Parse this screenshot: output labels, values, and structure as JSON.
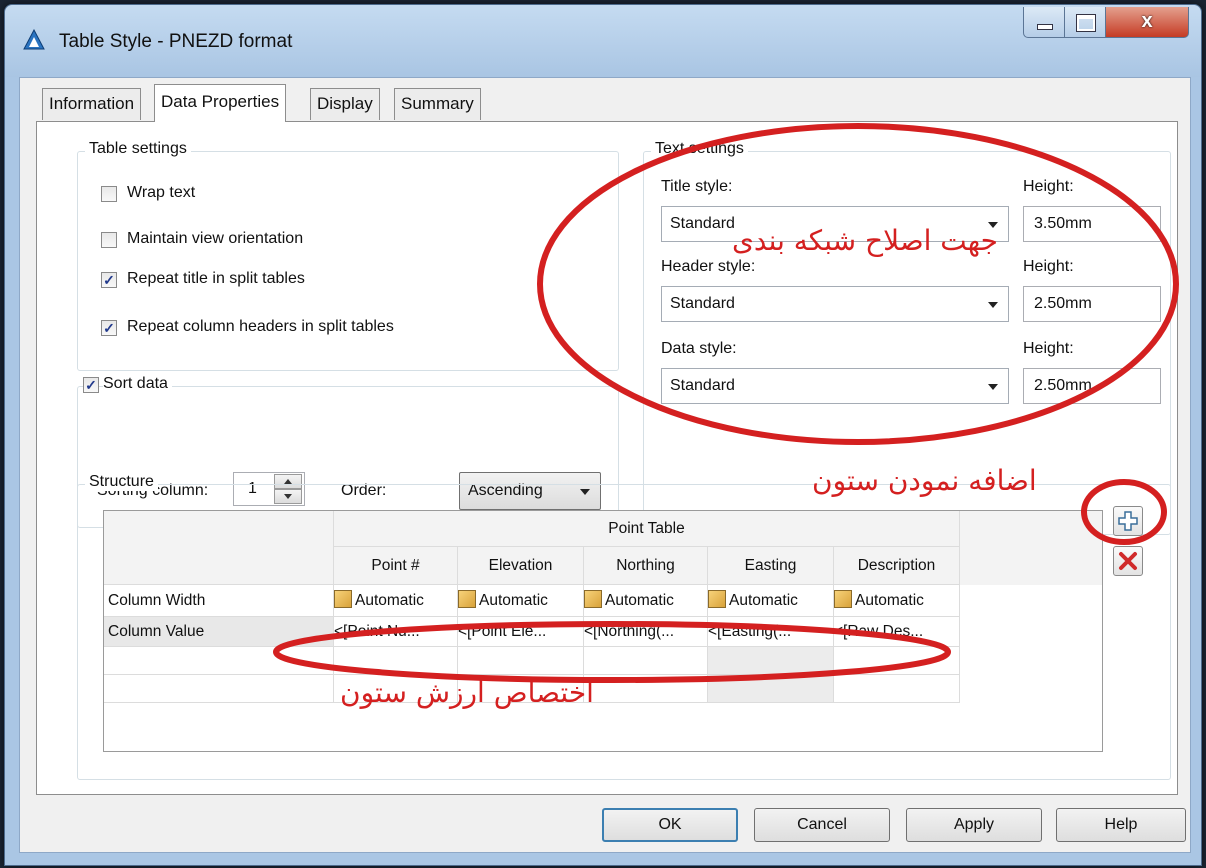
{
  "window": {
    "title": "Table Style - PNEZD format",
    "buttons": {
      "close": "x"
    }
  },
  "tabs": [
    {
      "label": "Information",
      "active": false
    },
    {
      "label": "Data Properties",
      "active": true
    },
    {
      "label": "Display",
      "active": false
    },
    {
      "label": "Summary",
      "active": false
    }
  ],
  "table_settings": {
    "title": "Table settings",
    "wrap_text": {
      "label": "Wrap text",
      "checked": false
    },
    "maintain_view": {
      "label": "Maintain view orientation",
      "checked": false
    },
    "repeat_title": {
      "label": "Repeat title in split tables",
      "checked": true
    },
    "repeat_headers": {
      "label": "Repeat column headers in split tables",
      "checked": true
    }
  },
  "sort": {
    "label": "Sort data",
    "checked": true,
    "column_label": "Sorting column:",
    "column_value": "1",
    "order_label": "Order:",
    "order_value": "Ascending"
  },
  "text_settings": {
    "title": "Text settings",
    "title_style": {
      "label": "Title style:",
      "value": "Standard",
      "height_label": "Height:",
      "height": "3.50mm"
    },
    "header_style": {
      "label": "Header style:",
      "value": "Standard",
      "height_label": "Height:",
      "height": "2.50mm"
    },
    "data_style": {
      "label": "Data style:",
      "value": "Standard",
      "height_label": "Height:",
      "height": "2.50mm"
    }
  },
  "structure": {
    "title": "Structure",
    "table_title": "Point Table",
    "columns": [
      "Point #",
      "Elevation",
      "Northing",
      "Easting",
      "Description"
    ],
    "rows": [
      {
        "label": "Column Width",
        "values": [
          "Automatic",
          "Automatic",
          "Automatic",
          "Automatic",
          "Automatic"
        ]
      },
      {
        "label": "Column Value",
        "values": [
          "<[Point Nu...",
          "<[Point Ele...",
          "<[Northing(...",
          "<[Easting(...",
          "<[Raw Des..."
        ]
      }
    ]
  },
  "annotations": {
    "text_settings_note": "جهت اصلاح شبکه بندی",
    "add_column_note": "اضافه نمودن ستون",
    "column_value_note": "اختصاص ارزش ستون",
    "color": "#d42020"
  },
  "footer": {
    "ok": "OK",
    "cancel": "Cancel",
    "apply": "Apply",
    "help": "Help"
  }
}
